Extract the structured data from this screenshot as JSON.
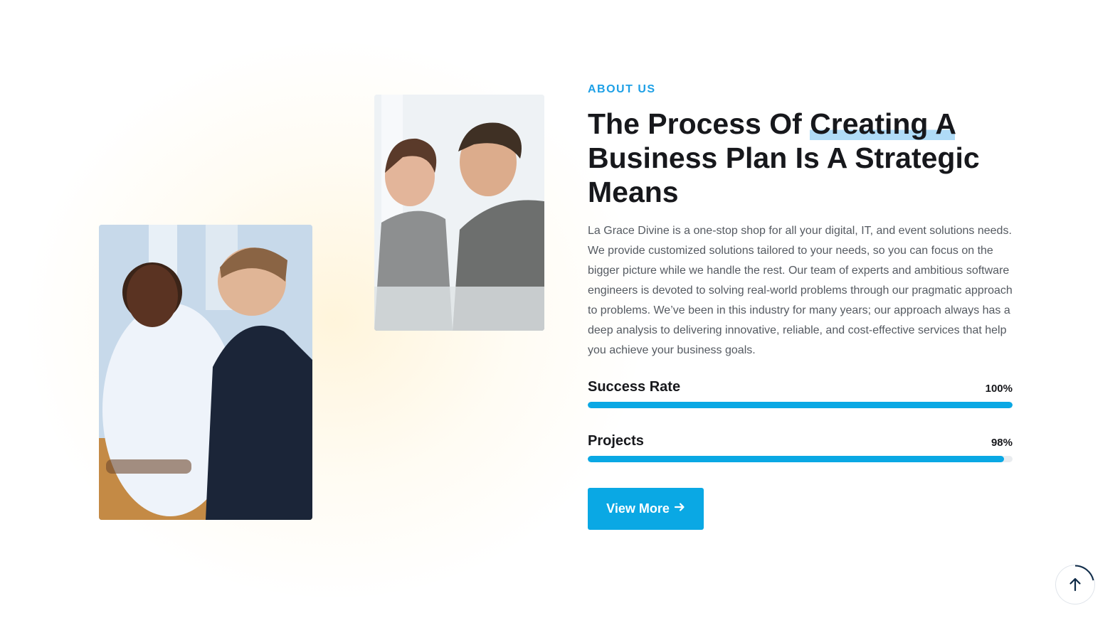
{
  "about": {
    "eyebrow": "ABOUT US",
    "headline_part1": "The Process Of ",
    "headline_highlight": "Creating A",
    "headline_part2": " Business Plan Is A Strategic Means",
    "description": "La Grace Divine is a one-stop shop for all your digital, IT, and event solutions needs. We provide customized solutions tailored to your needs, so you can focus on the bigger picture while we handle the rest. Our team of experts and ambitious software engineers is devoted to solving real-world problems through our pragmatic approach to problems. We’ve been in this industry for many years; our approach always has a deep analysis to delivering innovative, reliable, and cost-effective services that help you achieve your business goals."
  },
  "progress": [
    {
      "label": "Success Rate",
      "value_text": "100%",
      "value": 100
    },
    {
      "label": "Projects",
      "value_text": "98%",
      "value": 98
    }
  ],
  "button": {
    "label": "View More",
    "icon": "arrow-right-icon"
  },
  "scroll_top": {
    "icon": "arrow-up-icon"
  },
  "colors": {
    "accent": "#0aa8e4",
    "eyebrow": "#1ea0e6",
    "heading": "#17181c",
    "body_text": "#555a61"
  }
}
